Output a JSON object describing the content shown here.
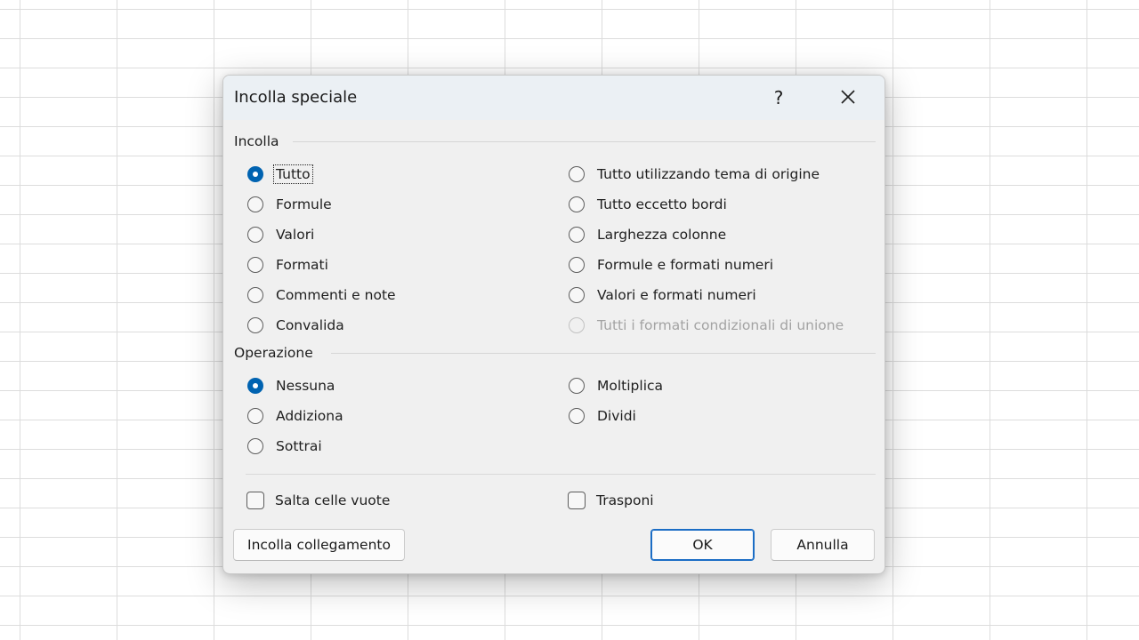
{
  "dialog": {
    "title": "Incolla speciale",
    "help": "?"
  },
  "paste_group": {
    "label": "Incolla",
    "options": [
      {
        "label": "Tutto",
        "selected": true,
        "enabled": true
      },
      {
        "label": "Formule",
        "selected": false,
        "enabled": true
      },
      {
        "label": "Valori",
        "selected": false,
        "enabled": true
      },
      {
        "label": "Formati",
        "selected": false,
        "enabled": true
      },
      {
        "label": "Commenti e note",
        "selected": false,
        "enabled": true
      },
      {
        "label": "Convalida",
        "selected": false,
        "enabled": true
      },
      {
        "label": "Tutto utilizzando tema di origine",
        "selected": false,
        "enabled": true
      },
      {
        "label": "Tutto eccetto bordi",
        "selected": false,
        "enabled": true
      },
      {
        "label": "Larghezza colonne",
        "selected": false,
        "enabled": true
      },
      {
        "label": "Formule e formati numeri",
        "selected": false,
        "enabled": true
      },
      {
        "label": "Valori e formati numeri",
        "selected": false,
        "enabled": true
      },
      {
        "label": "Tutti i formati condizionali di unione",
        "selected": false,
        "enabled": false
      }
    ]
  },
  "operation_group": {
    "label": "Operazione",
    "options": [
      {
        "label": "Nessuna",
        "selected": true
      },
      {
        "label": "Addiziona",
        "selected": false
      },
      {
        "label": "Sottrai",
        "selected": false
      },
      {
        "label": "Moltiplica",
        "selected": false
      },
      {
        "label": "Dividi",
        "selected": false
      }
    ]
  },
  "checkboxes": {
    "skip_blanks": {
      "label": "Salta celle vuote",
      "checked": false
    },
    "transpose": {
      "label": "Trasponi",
      "checked": false
    }
  },
  "buttons": {
    "paste_link": "Incolla collegamento",
    "ok": "OK",
    "cancel": "Annulla"
  },
  "colors": {
    "accent": "#0063b1",
    "dialog_bg": "#f0f0f0",
    "titlebar_bg": "#ebf0f4"
  }
}
